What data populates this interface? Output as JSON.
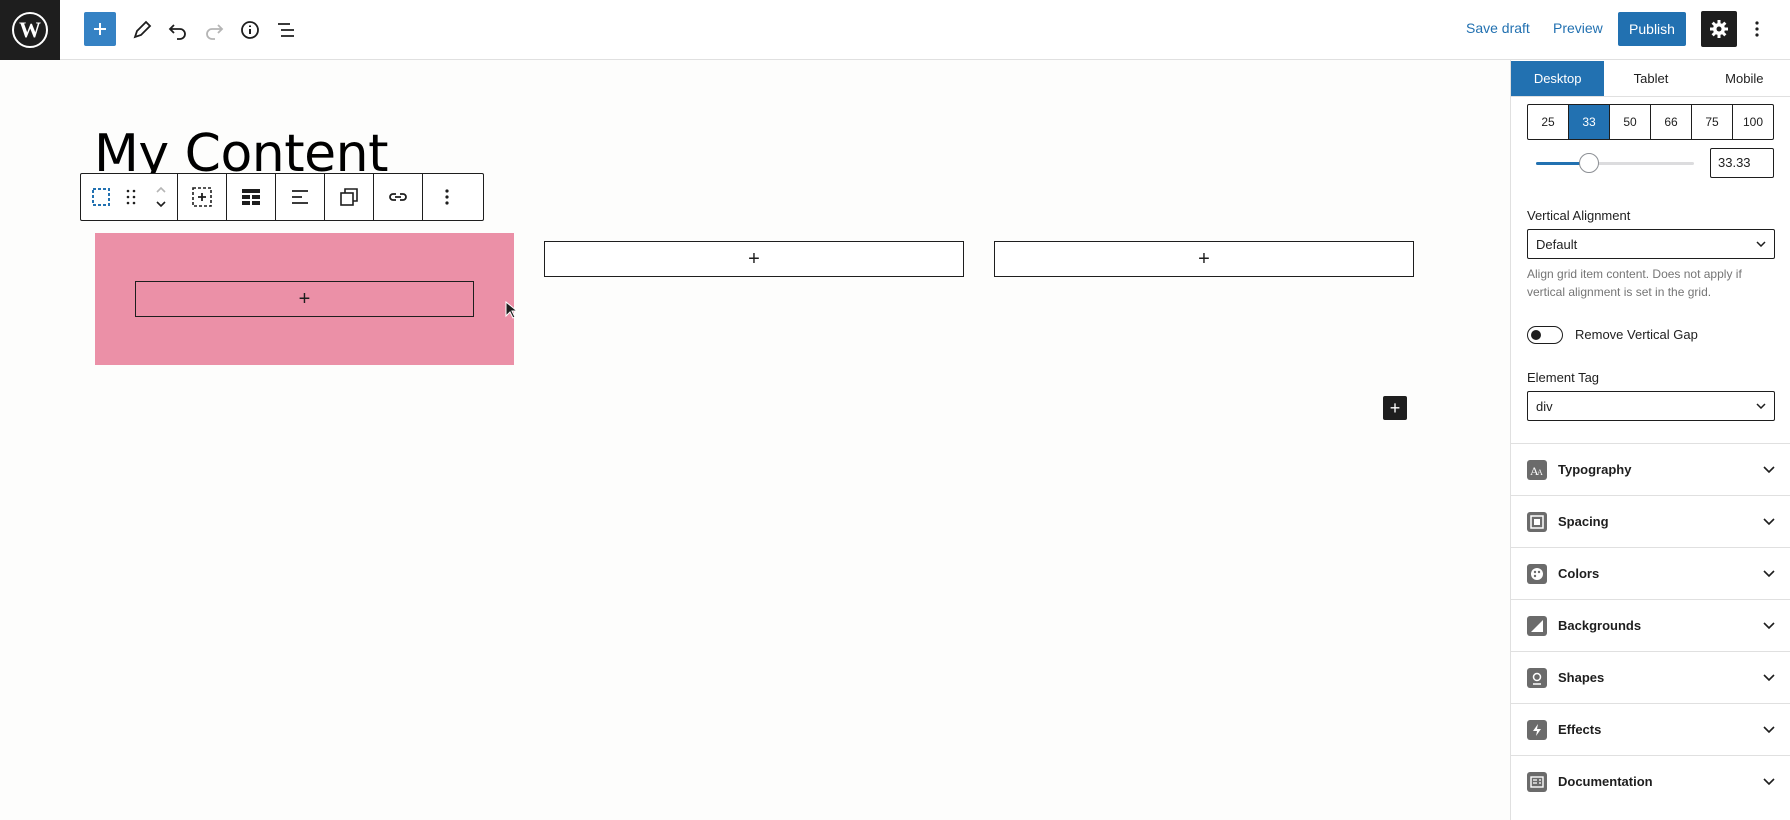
{
  "toolbar": {
    "save_draft": "Save draft",
    "preview": "Preview",
    "publish": "Publish"
  },
  "editor": {
    "title": "My Content",
    "appender_glyph": "+",
    "small_add_glyph": "+"
  },
  "sidebar": {
    "device_tabs": [
      "Desktop",
      "Tablet",
      "Mobile"
    ],
    "active_device": "Desktop",
    "width_presets": [
      "25",
      "33",
      "50",
      "66",
      "75",
      "100"
    ],
    "active_width": "33",
    "width_value": "33.33",
    "vertical_alignment": {
      "label": "Vertical Alignment",
      "value": "Default",
      "help": "Align grid item content. Does not apply if vertical alignment is set in the grid."
    },
    "remove_vertical_gap": {
      "label": "Remove Vertical Gap",
      "checked": false
    },
    "element_tag": {
      "label": "Element Tag",
      "value": "div"
    },
    "panels": [
      "Typography",
      "Spacing",
      "Colors",
      "Backgrounds",
      "Shapes",
      "Effects",
      "Documentation"
    ]
  },
  "colors": {
    "accent": "#2271b1",
    "block_background": "#eb90a7",
    "dark": "#1e1e1e"
  }
}
